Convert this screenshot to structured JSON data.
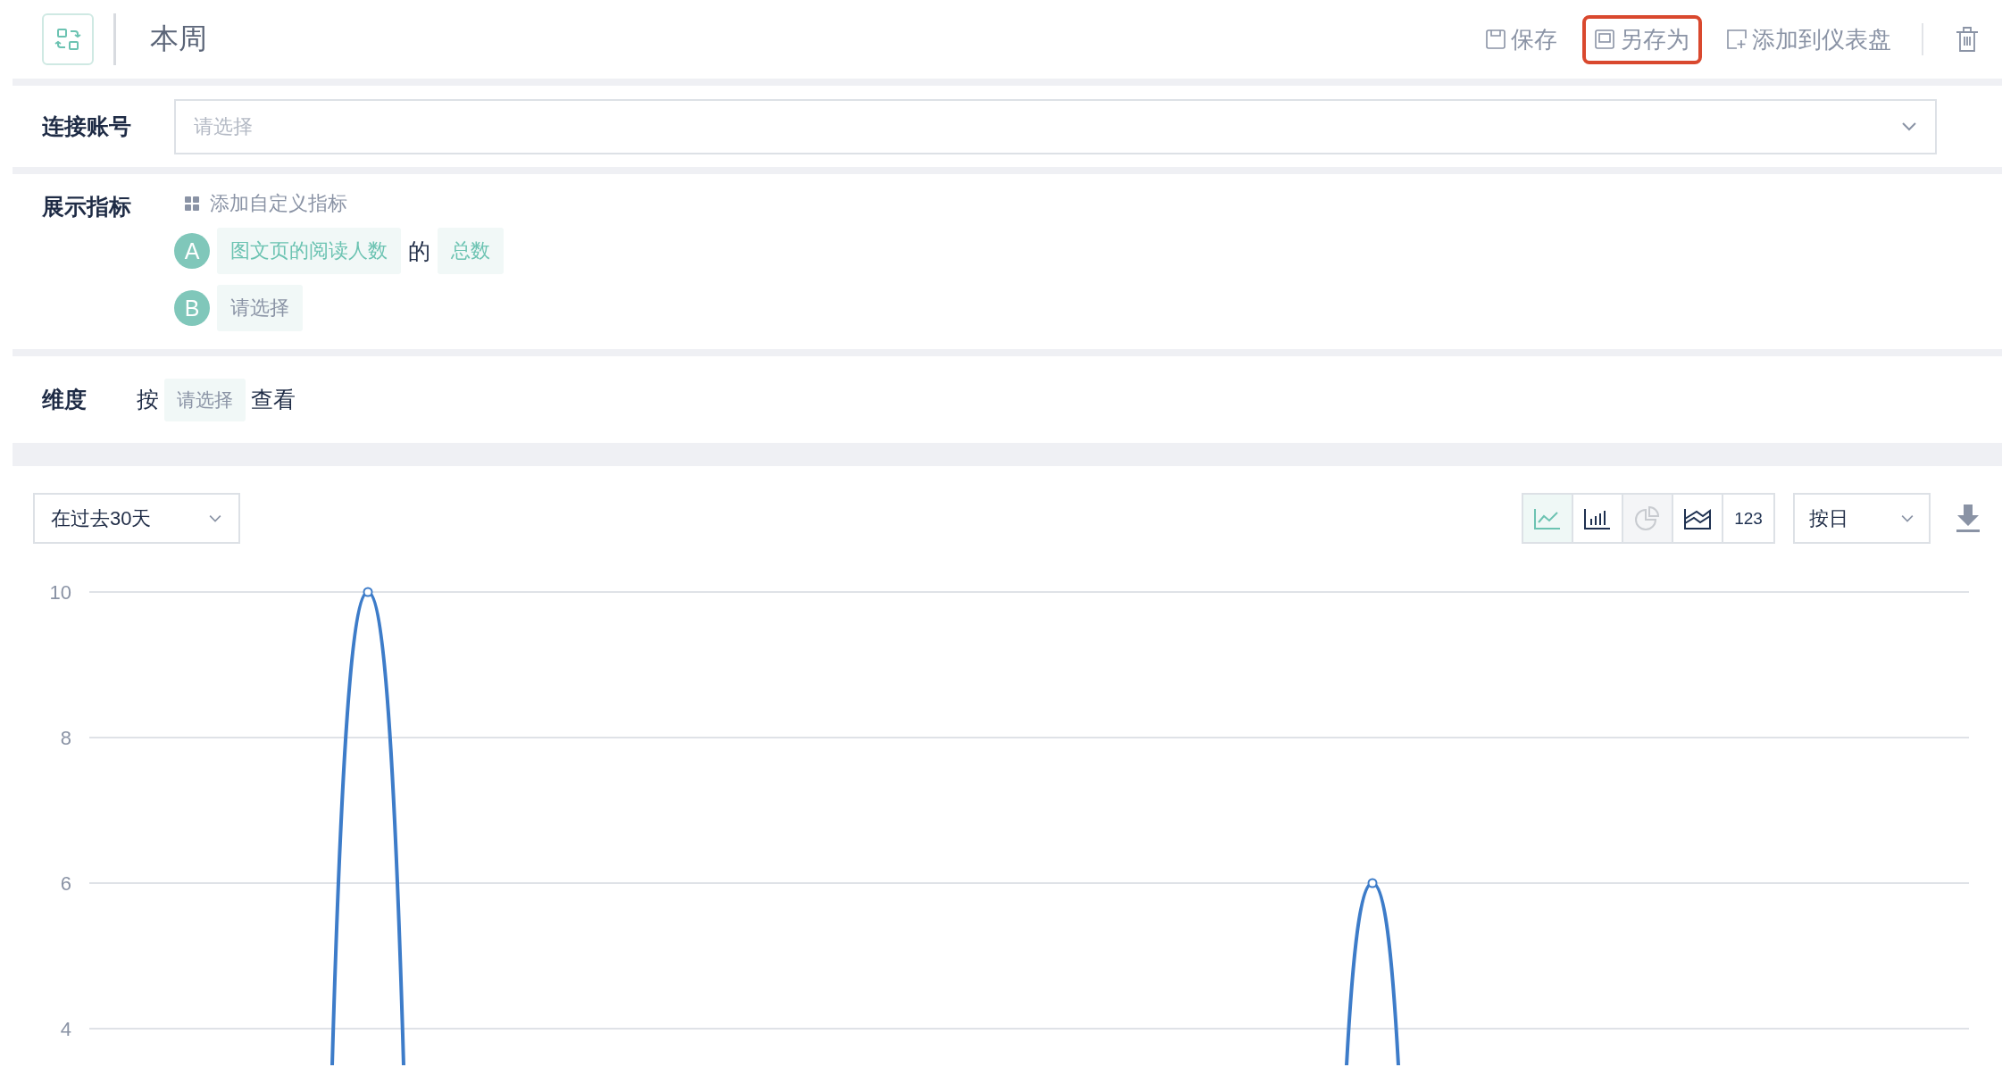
{
  "header": {
    "title": "本周",
    "actions": [
      {
        "kind": "save",
        "label": "保存",
        "highlighted": false
      },
      {
        "kind": "save-as",
        "label": "另存为",
        "highlighted": true
      },
      {
        "kind": "add",
        "label": "添加到仪表盘",
        "highlighted": false
      }
    ]
  },
  "account": {
    "label": "连接账号",
    "placeholder": "请选择"
  },
  "metrics": {
    "label": "展示指标",
    "add_label": "添加自定义指标",
    "items": [
      {
        "letter": "A",
        "parts": [
          {
            "kind": "chip",
            "text": "图文页的阅读人数"
          },
          {
            "kind": "word",
            "text": "的"
          },
          {
            "kind": "chip",
            "text": "总数"
          }
        ]
      },
      {
        "letter": "B",
        "parts": [
          {
            "kind": "placeholder",
            "text": "请选择"
          }
        ]
      }
    ]
  },
  "dimension": {
    "label": "维度",
    "prefix": "按",
    "placeholder": "请选择",
    "suffix": "查看"
  },
  "chart_panel": {
    "range": "在过去30天",
    "granularity": "按日",
    "chart_types": [
      {
        "kind": "line",
        "selected": true,
        "disabled": false
      },
      {
        "kind": "bar",
        "selected": false,
        "disabled": false
      },
      {
        "kind": "pie",
        "selected": false,
        "disabled": true
      },
      {
        "kind": "area",
        "selected": false,
        "disabled": false
      },
      {
        "kind": "number",
        "label": "123",
        "selected": false,
        "disabled": false
      }
    ],
    "y_axis_labels": [
      "10",
      "8",
      "6",
      "4"
    ]
  }
}
